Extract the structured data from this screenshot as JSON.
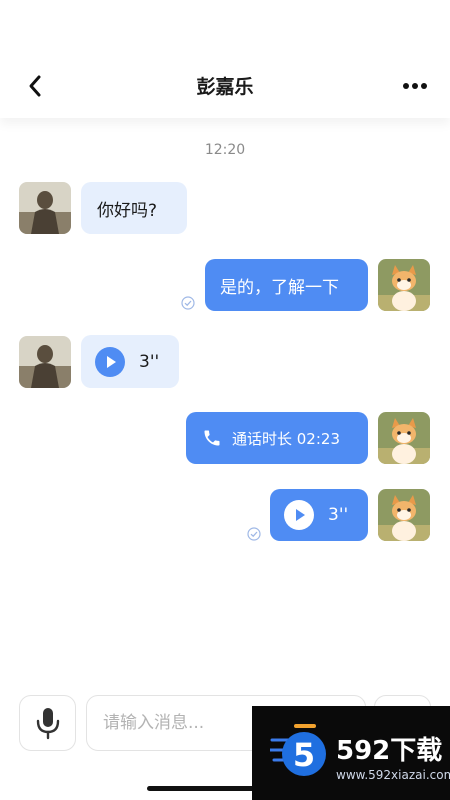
{
  "header": {
    "title": "彭嘉乐",
    "back_icon": "chevron-left-icon",
    "more_icon": "more-horizontal-icon"
  },
  "timestamp": "12:20",
  "messages": [
    {
      "side": "in",
      "type": "text",
      "text": "你好吗?"
    },
    {
      "side": "out",
      "type": "text",
      "text": "是的，了解一下",
      "read": true
    },
    {
      "side": "in",
      "type": "voice",
      "duration": "3''"
    },
    {
      "side": "out",
      "type": "call",
      "text": "通话时长 02:23"
    },
    {
      "side": "out",
      "type": "voice",
      "duration": "3''",
      "read": true
    }
  ],
  "input": {
    "placeholder": "请输入消息..."
  },
  "watermark": {
    "brand": "592下载",
    "url": "www.592xiazai.com",
    "logo_text": "5"
  },
  "colors": {
    "bubble_out": "#4f8cf3",
    "bubble_in": "#e6effd",
    "accent": "#4f8cf3"
  }
}
